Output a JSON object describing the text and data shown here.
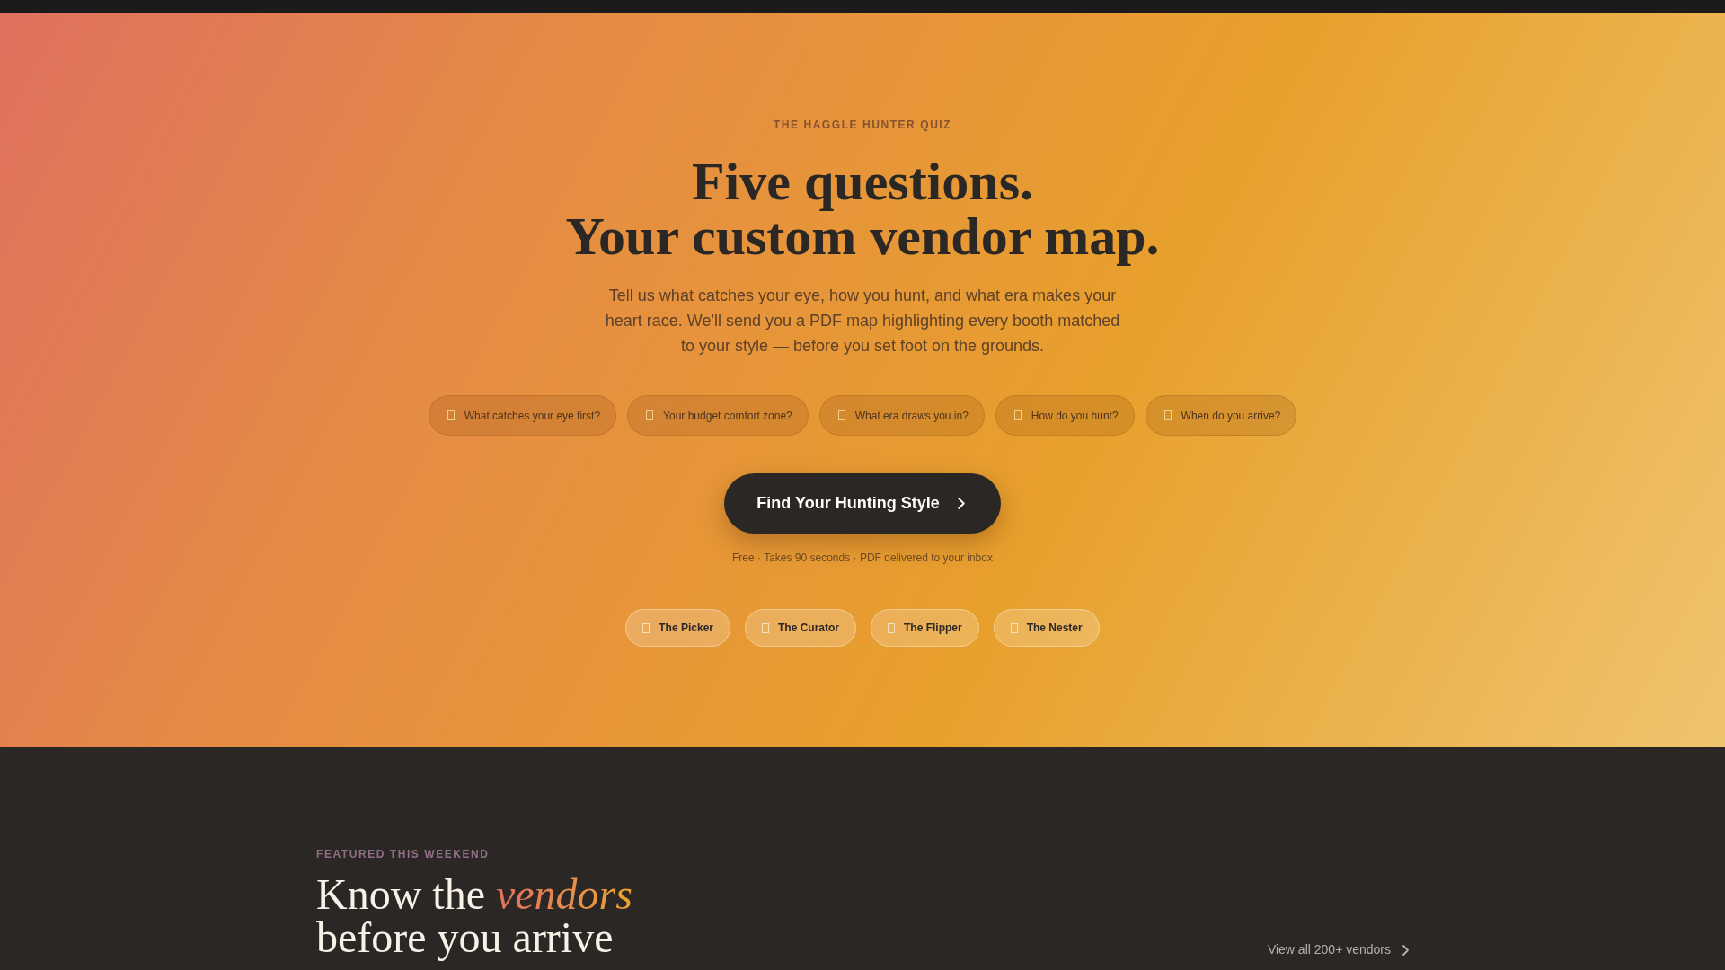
{
  "hero": {
    "eyebrow": "THE HAGGLE HUNTER QUIZ",
    "title_lines": [
      "Five questions.",
      "Your custom vendor map."
    ],
    "description": "Tell us what catches your eye, how you hunt, and what era makes your heart race. We'll send you a PDF map highlighting every booth matched to your style — before you set foot on the grounds.",
    "questions": [
      "What catches your eye first?",
      "Your budget comfort zone?",
      "What era draws you in?",
      "How do you hunt?",
      "When do you arrive?"
    ],
    "cta": {
      "label": "Find Your Hunting Style"
    },
    "note": "Free · Takes 90 seconds · PDF delivered to your inbox",
    "styles": [
      "The Picker",
      "The Curator",
      "The Flipper",
      "The Nester"
    ]
  },
  "featured": {
    "eyebrow": "FEATURED THIS WEEKEND",
    "title_lines": [
      "Know the *vendors*",
      "before you arrive"
    ],
    "link": "View all 200+ vendors"
  }
}
